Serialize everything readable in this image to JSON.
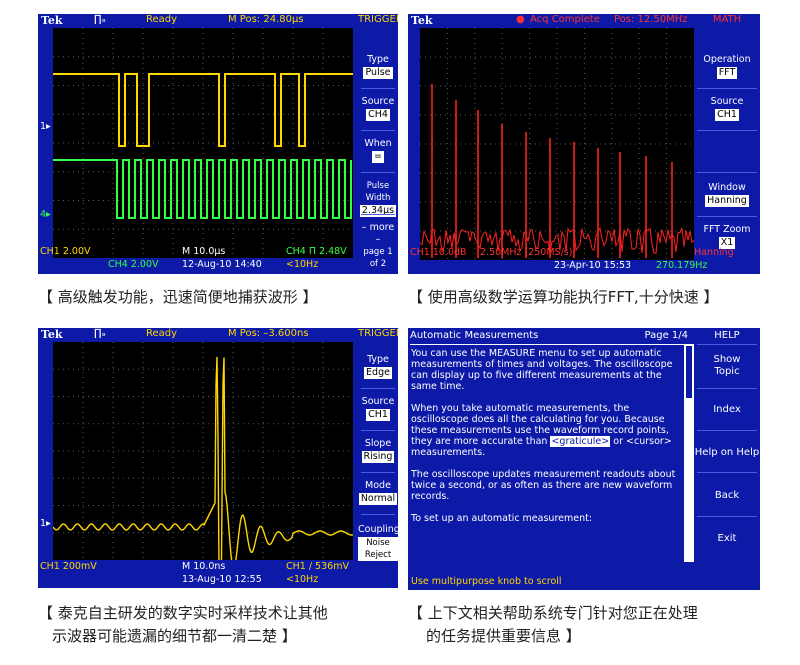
{
  "panels": {
    "pulse": {
      "brand": "Tek",
      "trigger_symbol": "∏ₔ",
      "status": "Ready",
      "mpos": "M Pos: 24.80µs",
      "menu_title": "TRIGGER",
      "menu": [
        {
          "label": "Type",
          "value": "Pulse"
        },
        {
          "label": "Source",
          "value": "CH4"
        },
        {
          "label": "When",
          "value": "="
        },
        {
          "label": "Pulse Width",
          "value": "2.34µs"
        },
        {
          "label": "– more –",
          "value": "page 1 of 2"
        }
      ],
      "ch1_scale": "CH1  2.00V",
      "ch4_scale": "CH4  2.00V",
      "timebase": "M 10.0µs",
      "date_time": "12-Aug-10 14:40",
      "trig_level": "CH4 Π 2.48V",
      "trig_freq": "<10Hz",
      "ch1_marker": "1▸",
      "ch4_marker": "4▸"
    },
    "fft": {
      "brand": "Tek",
      "status": "Acq Complete",
      "pos": "Pos: 12.50MHz",
      "menu_title": "MATH",
      "menu": [
        {
          "label": "Operation",
          "value": "FFT"
        },
        {
          "label": "Source",
          "value": "CH1"
        },
        {
          "label": "Window",
          "value": "Hanning"
        },
        {
          "label": "FFT Zoom",
          "value": "X1"
        }
      ],
      "ch_scale": "CH1 10.0dB",
      "freq_scale": "2.50MHz (250MS/s)",
      "window_label": "Hanning",
      "date_time": "23-Apr-10 15:53",
      "freq": "270.179Hz"
    },
    "edge": {
      "brand": "Tek",
      "trigger_symbol": "∏ₔ",
      "status": "Ready",
      "mpos": "M Pos: –3.600ns",
      "menu_title": "TRIGGER",
      "menu": [
        {
          "label": "Type",
          "value": "Edge"
        },
        {
          "label": "Source",
          "value": "CH1"
        },
        {
          "label": "Slope",
          "value": "Rising"
        },
        {
          "label": "Mode",
          "value": "Normal"
        },
        {
          "label": "Coupling",
          "value": "Noise Reject"
        }
      ],
      "ch1_scale": "CH1  200mV",
      "timebase": "M 10.0ns",
      "date_time": "13-Aug-10 12:55",
      "trig_level": "CH1 ∕ 536mV",
      "trig_freq": "<10Hz",
      "ch1_marker": "1▸"
    },
    "help": {
      "header": "Automatic Measurements",
      "page": "Page 1/4",
      "menu_title": "HELP",
      "menu": [
        "Show Topic",
        "Index",
        "Help on Help",
        "Back",
        "Exit"
      ],
      "para1": "You can use the MEASURE menu to set up automatic measurements of times and voltages. The oscilloscope can display up to five different measurements at the same time.",
      "para2_a": "When you take automatic measurements, the oscilloscope does all the calculating for you. Because these measurements use the waveform record points, they are more accurate than ",
      "graticule_link": "<graticule>",
      "para2_b": " or <cursor> measurements.",
      "para3": "The oscilloscope updates measurement readouts about twice a second, or as often as there are new waveform records.",
      "para4": "To set up an automatic measurement:",
      "footer": "Use multipurpose knob to scroll"
    }
  },
  "captions": {
    "c1": "【 高级触发功能，迅速简便地捕获波形 】",
    "c2": "【 使用高级数学运算功能执行FFT,十分快速 】",
    "c3a": "【 泰克自主研发的数字实时采样技术让其他",
    "c3b": "示波器可能遗漏的细节都一清二楚 】",
    "c4a": "【 上下文相关帮助系统专门针对您正在处理",
    "c4b": "的任务提供重要信息 】"
  },
  "colors": {
    "screen_frame": "#0d1aa8",
    "ch1_trace": "#ffd700",
    "ch4_trace": "#33ff44",
    "fft_trace": "#ff2020",
    "grid": "#6a6a6a"
  }
}
